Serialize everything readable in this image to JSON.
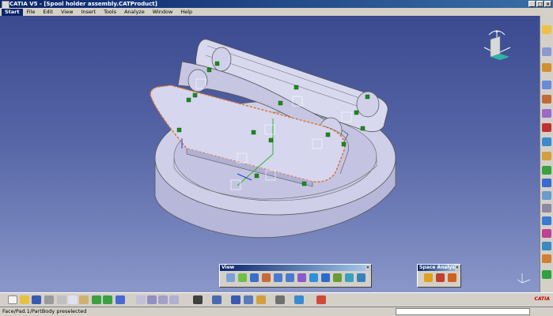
{
  "window": {
    "title": "CATIA V5 - [Spool holder assembly.CATProduct]",
    "buttons": [
      "_",
      "□",
      "×"
    ]
  },
  "menu": {
    "start": "Start",
    "items": [
      "File",
      "Edit",
      "View",
      "Insert",
      "Tools",
      "Analyze",
      "Window",
      "Help"
    ]
  },
  "palettes": {
    "view": {
      "title": "View",
      "close": "×"
    },
    "space_analysis": {
      "title": "Space Analysis",
      "close": "×"
    }
  },
  "status": {
    "text": "Face/Pad.1/PartBody preselected",
    "command_input": ""
  },
  "logo": "CATIA",
  "colors": {
    "viewport_top": "#3b4a8f",
    "viewport_bottom": "#8a97c9",
    "part_face": "#c9c9e6",
    "part_shade": "#a0a0c8",
    "selection_highlight": "#e07020",
    "constraint_green": "#1a8c1a"
  }
}
